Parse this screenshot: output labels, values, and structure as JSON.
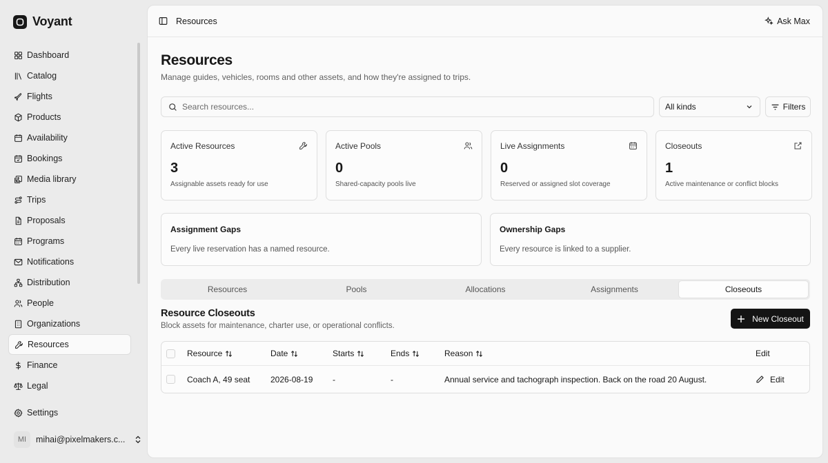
{
  "brand": {
    "name": "Voyant"
  },
  "sidebar": {
    "items": [
      {
        "label": "Dashboard",
        "icon": "dashboard-icon"
      },
      {
        "label": "Catalog",
        "icon": "catalog-icon"
      },
      {
        "label": "Flights",
        "icon": "plane-icon"
      },
      {
        "label": "Products",
        "icon": "package-icon"
      },
      {
        "label": "Availability",
        "icon": "calendar-icon"
      },
      {
        "label": "Bookings",
        "icon": "calendar-check-icon"
      },
      {
        "label": "Media library",
        "icon": "image-icon"
      },
      {
        "label": "Trips",
        "icon": "route-icon"
      },
      {
        "label": "Proposals",
        "icon": "file-icon"
      },
      {
        "label": "Programs",
        "icon": "calendar-grid-icon"
      },
      {
        "label": "Notifications",
        "icon": "mail-icon"
      },
      {
        "label": "Distribution",
        "icon": "network-icon"
      },
      {
        "label": "People",
        "icon": "users-icon"
      },
      {
        "label": "Organizations",
        "icon": "building-icon"
      },
      {
        "label": "Resources",
        "icon": "wrench-icon",
        "active": true
      },
      {
        "label": "Finance",
        "icon": "dollar-icon"
      },
      {
        "label": "Legal",
        "icon": "scale-icon"
      }
    ],
    "settings_label": "Settings",
    "user": {
      "initials": "MI",
      "email": "mihai@pixelmakers.c..."
    }
  },
  "topbar": {
    "breadcrumb": "Resources",
    "ask_label": "Ask Max"
  },
  "page": {
    "title": "Resources",
    "subtitle": "Manage guides, vehicles, rooms and other assets, and how they're assigned to trips."
  },
  "search": {
    "placeholder": "Search resources...",
    "value": ""
  },
  "kind_filter": {
    "selected": "All kinds"
  },
  "filters_label": "Filters",
  "stats": [
    {
      "title": "Active Resources",
      "value": "3",
      "sub": "Assignable assets ready for use",
      "icon": "wrench-icon"
    },
    {
      "title": "Active Pools",
      "value": "0",
      "sub": "Shared-capacity pools live",
      "icon": "users-icon"
    },
    {
      "title": "Live Assignments",
      "value": "0",
      "sub": "Reserved or assigned slot coverage",
      "icon": "calendar-icon"
    },
    {
      "title": "Closeouts",
      "value": "1",
      "sub": "Active maintenance or conflict blocks",
      "icon": "external-link-icon"
    }
  ],
  "gaps": [
    {
      "title": "Assignment Gaps",
      "text": "Every live reservation has a named resource."
    },
    {
      "title": "Ownership Gaps",
      "text": "Every resource is linked to a supplier."
    }
  ],
  "tabs": [
    {
      "label": "Resources"
    },
    {
      "label": "Pools"
    },
    {
      "label": "Allocations"
    },
    {
      "label": "Assignments"
    },
    {
      "label": "Closeouts",
      "active": true
    }
  ],
  "section": {
    "title": "Resource Closeouts",
    "subtitle": "Block assets for maintenance, charter use, or operational conflicts.",
    "new_button": "New Closeout"
  },
  "table": {
    "columns": [
      "Resource",
      "Date",
      "Starts",
      "Ends",
      "Reason",
      "Edit"
    ],
    "rows": [
      {
        "resource": "Coach A, 49 seat",
        "date": "2026-08-19",
        "starts": "-",
        "ends": "-",
        "reason": "Annual service and tachograph inspection. Back on the road 20 August.",
        "edit": "Edit"
      }
    ]
  },
  "colors": {
    "accent": "#141414",
    "background": "#ebebeb",
    "panel": "#fafafa"
  }
}
